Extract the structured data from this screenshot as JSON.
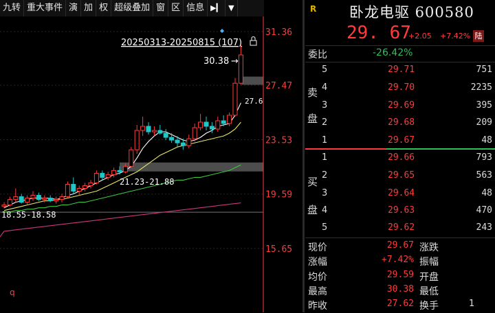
{
  "toolbar": {
    "items": [
      "九转",
      "重大事件",
      "演",
      "加",
      "权",
      "超级叠加",
      "窗",
      "区",
      "信息"
    ],
    "icon_next": "▶▎",
    "icon_menu": "▼"
  },
  "chart": {
    "range_label": "20250313-20250815 (107)",
    "high_label": "30.38",
    "high_arrow": "→",
    "right_cut_label": "27.6",
    "zone_label": "21.23-21.88",
    "low_label": "18.55-18.58",
    "corner_label": "q",
    "y_ticks": [
      "31.36",
      "27.47",
      "23.53",
      "19.59",
      "15.65"
    ],
    "colors": {
      "up": "#ff3b3b",
      "down": "#21c7c7",
      "ma5": "#ffffff",
      "ma10": "#e8e86a",
      "ma20": "#3ec83e",
      "ma60": "#d0357a"
    }
  },
  "chart_data": {
    "type": "candlestick",
    "title": "20250313-20250815 (107)",
    "ylim": [
      14.5,
      32.5
    ],
    "y_ticks": [
      31.36,
      27.47,
      23.53,
      19.59,
      15.65
    ],
    "candles": [
      {
        "o": 18.7,
        "h": 19.0,
        "l": 18.55,
        "c": 18.8
      },
      {
        "o": 18.8,
        "h": 19.4,
        "l": 18.7,
        "c": 19.2
      },
      {
        "o": 19.2,
        "h": 20.0,
        "l": 19.0,
        "c": 19.4
      },
      {
        "o": 19.4,
        "h": 19.6,
        "l": 18.9,
        "c": 19.0
      },
      {
        "o": 19.0,
        "h": 19.5,
        "l": 18.8,
        "c": 19.3
      },
      {
        "o": 19.3,
        "h": 19.8,
        "l": 19.1,
        "c": 19.5
      },
      {
        "o": 19.5,
        "h": 19.7,
        "l": 19.1,
        "c": 19.2
      },
      {
        "o": 19.2,
        "h": 19.5,
        "l": 19.0,
        "c": 19.3
      },
      {
        "o": 19.3,
        "h": 19.5,
        "l": 19.0,
        "c": 19.1
      },
      {
        "o": 19.1,
        "h": 19.4,
        "l": 18.9,
        "c": 19.2
      },
      {
        "o": 19.2,
        "h": 19.6,
        "l": 19.0,
        "c": 19.4
      },
      {
        "o": 19.4,
        "h": 20.5,
        "l": 19.3,
        "c": 20.3
      },
      {
        "o": 20.3,
        "h": 20.8,
        "l": 19.6,
        "c": 19.8
      },
      {
        "o": 19.8,
        "h": 20.2,
        "l": 19.5,
        "c": 20.0
      },
      {
        "o": 20.0,
        "h": 20.4,
        "l": 19.8,
        "c": 20.2
      },
      {
        "o": 20.2,
        "h": 20.6,
        "l": 20.0,
        "c": 20.4
      },
      {
        "o": 20.4,
        "h": 21.3,
        "l": 20.3,
        "c": 21.1
      },
      {
        "o": 21.1,
        "h": 21.3,
        "l": 20.6,
        "c": 20.8
      },
      {
        "o": 20.8,
        "h": 21.2,
        "l": 20.6,
        "c": 21.0
      },
      {
        "o": 21.0,
        "h": 21.5,
        "l": 20.8,
        "c": 21.3
      },
      {
        "o": 21.3,
        "h": 21.6,
        "l": 21.0,
        "c": 21.2
      },
      {
        "o": 21.2,
        "h": 21.8,
        "l": 21.1,
        "c": 21.6
      },
      {
        "o": 21.6,
        "h": 23.0,
        "l": 21.5,
        "c": 22.8
      },
      {
        "o": 22.8,
        "h": 24.6,
        "l": 22.5,
        "c": 24.2
      },
      {
        "o": 24.2,
        "h": 25.2,
        "l": 23.8,
        "c": 24.5
      },
      {
        "o": 24.5,
        "h": 24.8,
        "l": 23.9,
        "c": 24.1
      },
      {
        "o": 24.1,
        "h": 24.5,
        "l": 23.8,
        "c": 24.2
      },
      {
        "o": 24.2,
        "h": 24.6,
        "l": 23.9,
        "c": 24.0
      },
      {
        "o": 24.0,
        "h": 24.3,
        "l": 23.5,
        "c": 23.7
      },
      {
        "o": 23.7,
        "h": 24.0,
        "l": 23.3,
        "c": 23.5
      },
      {
        "o": 23.5,
        "h": 23.8,
        "l": 23.0,
        "c": 23.3
      },
      {
        "o": 23.3,
        "h": 23.6,
        "l": 22.8,
        "c": 23.1
      },
      {
        "o": 23.1,
        "h": 23.9,
        "l": 22.9,
        "c": 23.6
      },
      {
        "o": 23.6,
        "h": 24.7,
        "l": 23.4,
        "c": 24.4
      },
      {
        "o": 24.4,
        "h": 25.4,
        "l": 24.2,
        "c": 24.8
      },
      {
        "o": 24.8,
        "h": 25.2,
        "l": 24.2,
        "c": 24.5
      },
      {
        "o": 24.5,
        "h": 24.8,
        "l": 24.0,
        "c": 24.3
      },
      {
        "o": 24.3,
        "h": 25.2,
        "l": 24.1,
        "c": 24.9
      },
      {
        "o": 24.9,
        "h": 25.3,
        "l": 24.5,
        "c": 24.7
      },
      {
        "o": 24.7,
        "h": 25.5,
        "l": 24.5,
        "c": 25.3
      },
      {
        "o": 25.3,
        "h": 28.0,
        "l": 25.2,
        "c": 27.62
      },
      {
        "o": 27.62,
        "h": 30.38,
        "l": 27.5,
        "c": 29.67
      }
    ],
    "ma_series": [
      {
        "name": "MA5",
        "color": "#ffffff",
        "values": [
          18.6,
          18.8,
          19.0,
          19.1,
          19.2,
          19.3,
          19.3,
          19.3,
          19.3,
          19.2,
          19.3,
          19.5,
          19.6,
          19.8,
          20.0,
          20.2,
          20.4,
          20.6,
          20.8,
          21.0,
          21.1,
          21.3,
          21.6,
          22.2,
          22.9,
          23.4,
          23.8,
          24.1,
          24.1,
          23.9,
          23.7,
          23.5,
          23.4,
          23.5,
          23.7,
          24.0,
          24.2,
          24.5,
          24.6,
          24.7,
          25.3,
          26.2
        ]
      },
      {
        "name": "MA10",
        "color": "#e8e86a",
        "values": [
          18.4,
          18.5,
          18.6,
          18.7,
          18.8,
          18.9,
          19.0,
          19.1,
          19.1,
          19.2,
          19.2,
          19.3,
          19.4,
          19.5,
          19.6,
          19.7,
          19.8,
          20.0,
          20.2,
          20.4,
          20.6,
          20.8,
          21.0,
          21.2,
          21.5,
          21.8,
          22.1,
          22.4,
          22.6,
          22.8,
          23.0,
          23.1,
          23.2,
          23.3,
          23.4,
          23.5,
          23.6,
          23.7,
          23.8,
          24.0,
          24.3,
          24.8
        ]
      },
      {
        "name": "MA20",
        "color": "#3ec83e",
        "values": [
          18.3,
          18.3,
          18.4,
          18.4,
          18.5,
          18.5,
          18.6,
          18.6,
          18.7,
          18.7,
          18.8,
          18.8,
          18.9,
          19.0,
          19.0,
          19.1,
          19.2,
          19.3,
          19.4,
          19.5,
          19.6,
          19.7,
          19.8,
          19.9,
          20.0,
          20.1,
          20.2,
          20.3,
          20.4,
          20.5,
          20.6,
          20.6,
          20.7,
          20.8,
          20.8,
          20.9,
          21.0,
          21.1,
          21.2,
          21.3,
          21.5,
          21.7
        ]
      },
      {
        "name": "MA60",
        "color": "#d0357a",
        "values": [
          16.9,
          16.95,
          17.0,
          17.05,
          17.1,
          17.15,
          17.2,
          17.25,
          17.3,
          17.35,
          17.4,
          17.45,
          17.5,
          17.55,
          17.6,
          17.65,
          17.7,
          17.75,
          17.8,
          17.85,
          17.9,
          17.95,
          18.0,
          18.05,
          18.1,
          18.15,
          18.2,
          18.25,
          18.3,
          18.35,
          18.4,
          18.45,
          18.5,
          18.55,
          18.6,
          18.65,
          18.7,
          18.75,
          18.8,
          18.85,
          18.9,
          18.95
        ]
      }
    ],
    "zones": [
      {
        "label": "21.23-21.88",
        "from": 21.23,
        "to": 21.88
      },
      {
        "label": "27.6",
        "from": 27.5,
        "to": 28.1
      }
    ],
    "annotations": [
      {
        "text": "30.38",
        "value": 30.38
      },
      {
        "text": "18.55-18.58",
        "value": 18.58
      }
    ]
  },
  "panel": {
    "stock_name": "卧龙电驱 600580",
    "logo": "R",
    "price": "29. 67",
    "change": "+2.05",
    "change_pct": "+7.42%",
    "market_badge": "陆",
    "weibi_label": "委比",
    "weibi_value": "-26.42%",
    "sell_label": [
      "卖",
      "盘"
    ],
    "buy_label": [
      "买",
      "盘"
    ],
    "sell_levels": [
      {
        "level": "5",
        "price": "29.71",
        "volume": "751"
      },
      {
        "level": "4",
        "price": "29.70",
        "volume": "2235"
      },
      {
        "level": "3",
        "price": "29.69",
        "volume": "395"
      },
      {
        "level": "2",
        "price": "29.68",
        "volume": "209"
      },
      {
        "level": "1",
        "price": "29.67",
        "volume": "48"
      }
    ],
    "buy_levels": [
      {
        "level": "1",
        "price": "29.66",
        "volume": "793"
      },
      {
        "level": "2",
        "price": "29.65",
        "volume": "563"
      },
      {
        "level": "3",
        "price": "29.64",
        "volume": "48"
      },
      {
        "level": "4",
        "price": "29.63",
        "volume": "470"
      },
      {
        "level": "5",
        "price": "29.62",
        "volume": "243"
      }
    ],
    "quote": [
      {
        "label": "现价",
        "value": "29.67",
        "label2": "涨跌",
        "value2": ""
      },
      {
        "label": "涨幅",
        "value": "+7.42%",
        "label2": "振幅",
        "value2": ""
      },
      {
        "label": "均价",
        "value": "29.59",
        "label2": "开盘",
        "value2": ""
      },
      {
        "label": "最高",
        "value": "30.38",
        "label2": "最低",
        "value2": ""
      },
      {
        "label": "昨收",
        "value": "27.62",
        "label2": "换手",
        "value2": "1"
      }
    ]
  }
}
